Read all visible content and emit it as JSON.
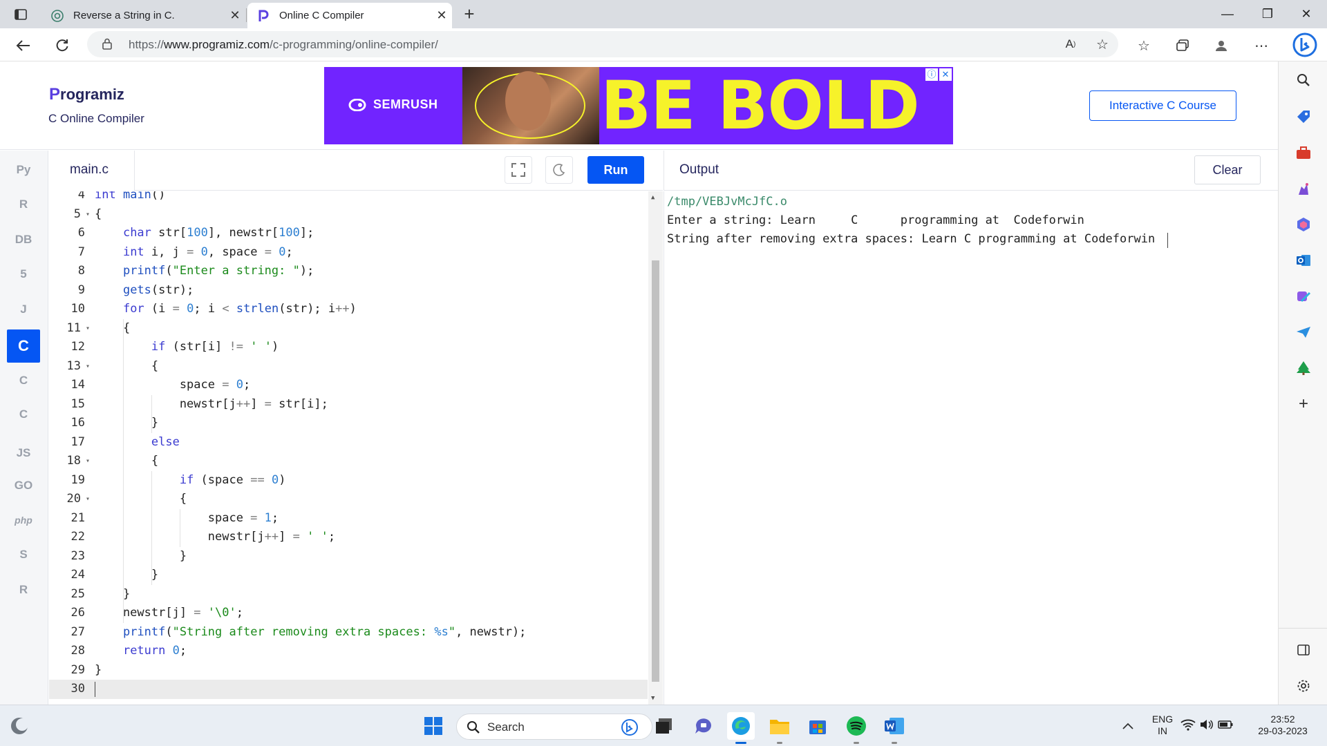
{
  "browser": {
    "tabs": [
      {
        "title": "Reverse a String in C.",
        "active": false,
        "favicon": "chatgpt-icon"
      },
      {
        "title": "Online C Compiler",
        "active": true,
        "favicon": "programiz-icon"
      }
    ],
    "url_prefix": "https://",
    "url_domain": "www.programiz.com",
    "url_path": "/c-programming/online-compiler/",
    "read_aloud_label": "A",
    "new_tab": "+"
  },
  "site": {
    "logo_initial": "P",
    "logo_rest": "rogramiz",
    "subtitle": "C Online Compiler",
    "course_button": "Interactive C Course"
  },
  "ad": {
    "brand": "SEMRUSH",
    "headline": "BE BOLD",
    "info": "ⓘ",
    "close": "✕"
  },
  "editor": {
    "file_name": "main.c",
    "run_label": "Run",
    "lines": [
      {
        "n": "4",
        "text": "int main()"
      },
      {
        "n": "5",
        "text": "{",
        "fold": true
      },
      {
        "n": "6",
        "text": "    char str[100], newstr[100];"
      },
      {
        "n": "7",
        "text": "    int i, j = 0, space = 0;"
      },
      {
        "n": "8",
        "text": "    printf(\"Enter a string: \");"
      },
      {
        "n": "9",
        "text": "    gets(str);"
      },
      {
        "n": "10",
        "text": "    for (i = 0; i < strlen(str); i++)"
      },
      {
        "n": "11",
        "text": "    {",
        "fold": true
      },
      {
        "n": "12",
        "text": "        if (str[i] != ' ')"
      },
      {
        "n": "13",
        "text": "        {",
        "fold": true
      },
      {
        "n": "14",
        "text": "            space = 0;"
      },
      {
        "n": "15",
        "text": "            newstr[j++] = str[i];"
      },
      {
        "n": "16",
        "text": "        }"
      },
      {
        "n": "17",
        "text": "        else"
      },
      {
        "n": "18",
        "text": "        {",
        "fold": true
      },
      {
        "n": "19",
        "text": "            if (space == 0)"
      },
      {
        "n": "20",
        "text": "            {",
        "fold": true
      },
      {
        "n": "21",
        "text": "                space = 1;"
      },
      {
        "n": "22",
        "text": "                newstr[j++] = ' ';"
      },
      {
        "n": "23",
        "text": "            }"
      },
      {
        "n": "24",
        "text": "        }"
      },
      {
        "n": "25",
        "text": "    }"
      },
      {
        "n": "26",
        "text": "    newstr[j] = '\\0';"
      },
      {
        "n": "27",
        "text": "    printf(\"String after removing extra spaces: %s\", newstr);"
      },
      {
        "n": "28",
        "text": "    return 0;"
      },
      {
        "n": "29",
        "text": "}"
      },
      {
        "n": "30",
        "text": ""
      }
    ]
  },
  "output": {
    "title": "Output",
    "clear_label": "Clear",
    "lines": [
      "/tmp/VEBJvMcJfC.o",
      "Enter a string: Learn     C      programming at  Codeforwin",
      "String after removing extra spaces: Learn C programming at Codeforwin"
    ]
  },
  "languages": [
    {
      "name": "python-icon",
      "glyph": "Py"
    },
    {
      "name": "r-icon",
      "glyph": "R"
    },
    {
      "name": "sql-icon",
      "glyph": "DB"
    },
    {
      "name": "html-icon",
      "glyph": "5"
    },
    {
      "name": "java-icon",
      "glyph": "J"
    },
    {
      "name": "c-icon",
      "glyph": "C",
      "active": true
    },
    {
      "name": "cpp-icon",
      "glyph": "C"
    },
    {
      "name": "csharp-icon",
      "glyph": "C"
    },
    {
      "name": "javascript-icon",
      "glyph": "JS"
    },
    {
      "name": "go-icon",
      "glyph": "GO"
    },
    {
      "name": "php-icon",
      "glyph": "php"
    },
    {
      "name": "swift-icon",
      "glyph": "S"
    },
    {
      "name": "rust-icon",
      "glyph": "R"
    }
  ],
  "taskbar": {
    "search_label": "Search",
    "lang_line1": "ENG",
    "lang_line2": "IN",
    "time": "23:52",
    "date": "29-03-2023"
  },
  "colors": {
    "accent": "#0556f3",
    "ad_bg": "#7124ff",
    "ad_yellow": "#f6f22a"
  }
}
